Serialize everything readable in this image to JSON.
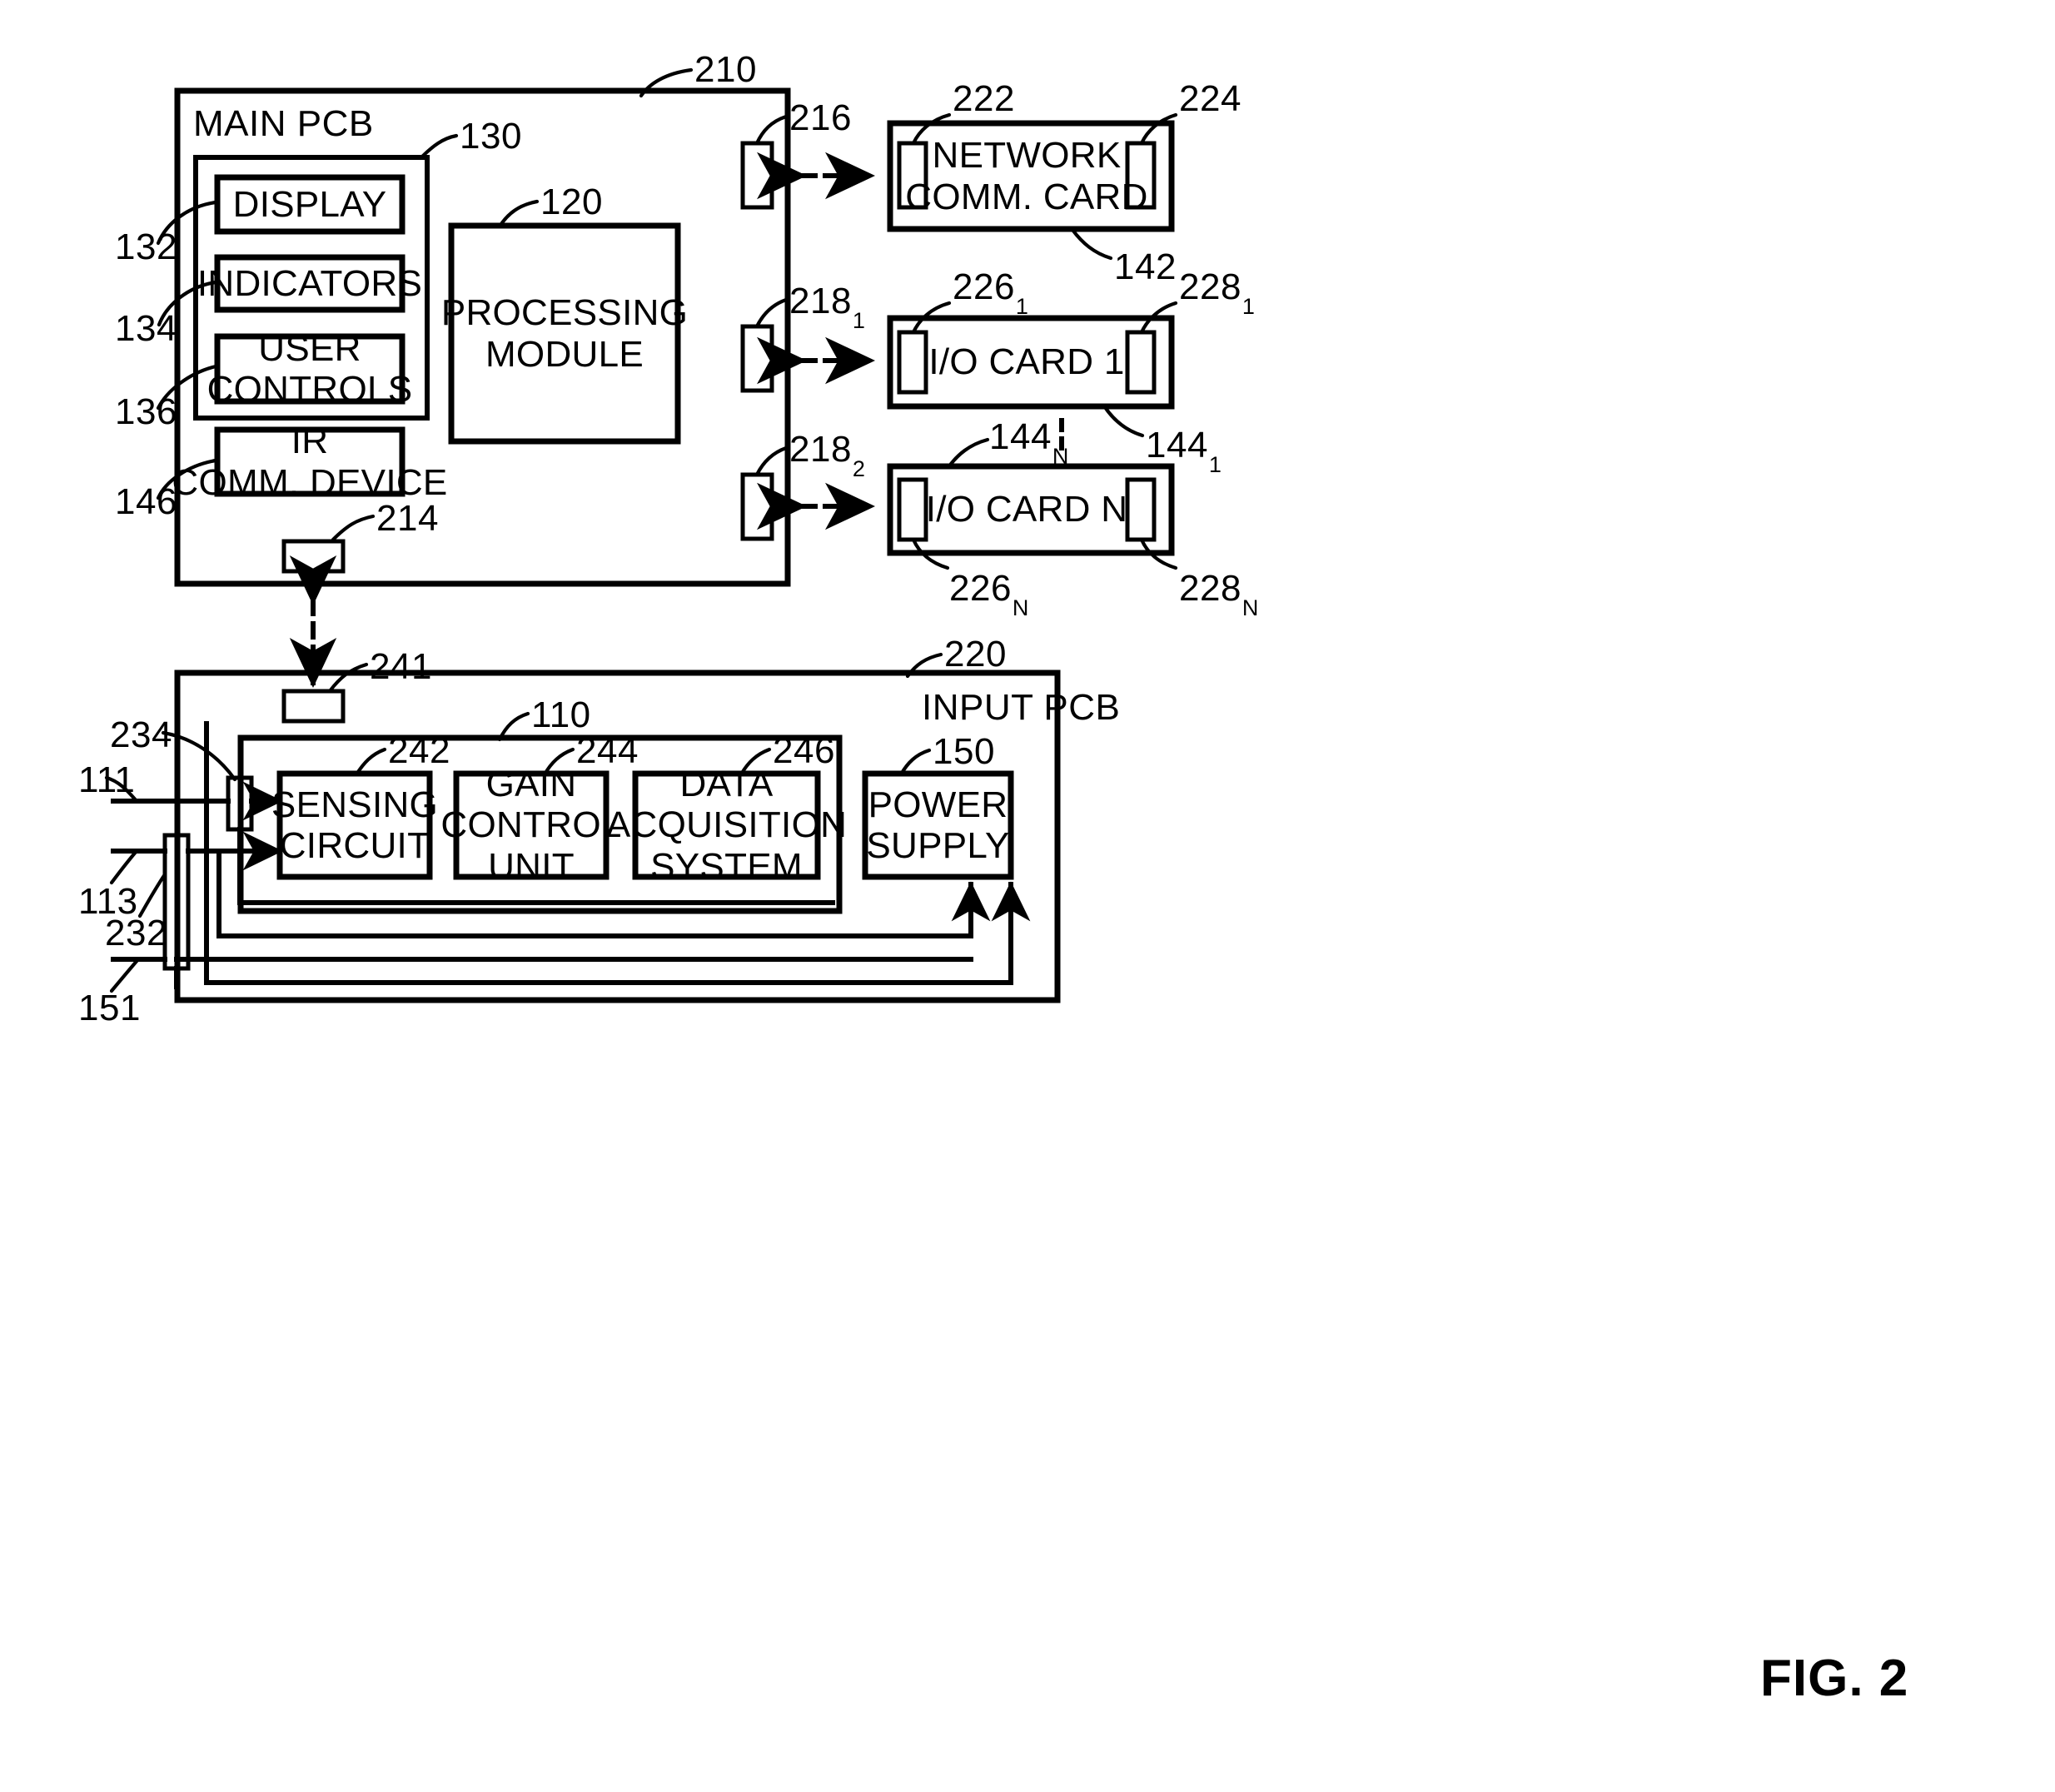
{
  "figure": {
    "caption": "FIG. 2"
  },
  "main_pcb": {
    "title": "MAIN PCB",
    "ref": "210",
    "ui_group_ref": "130",
    "boxes": [
      {
        "label": "DISPLAY",
        "ref": "132"
      },
      {
        "label": "INDICATORS",
        "ref": "134"
      },
      {
        "label": "USER\nCONTROLS",
        "ref": "136"
      },
      {
        "label": "IR\nCOMM. DEVICE",
        "ref": "146"
      }
    ],
    "processing_module": {
      "label": "PROCESSING\nMODULE",
      "ref": "120"
    },
    "bottom_connector_ref": "214",
    "edge_connectors": [
      {
        "ref": "216",
        "sub": ""
      },
      {
        "ref": "218",
        "sub": "1"
      },
      {
        "ref": "218",
        "sub": "2"
      }
    ]
  },
  "cards": [
    {
      "label": "NETWORK\nCOMM. CARD",
      "card_ref": "142",
      "card_sub": "",
      "left_connector_ref": "222",
      "left_connector_sub": "",
      "right_connector_ref": "224",
      "right_connector_sub": ""
    },
    {
      "label": "I/O CARD 1",
      "card_ref": "144",
      "card_sub": "1",
      "left_connector_ref": "226",
      "left_connector_sub": "1",
      "right_connector_ref": "228",
      "right_connector_sub": "1"
    },
    {
      "label": "I/O CARD N",
      "card_ref": "144",
      "card_sub": "N",
      "left_connector_ref": "226",
      "left_connector_sub": "N",
      "right_connector_ref": "228",
      "right_connector_sub": "N"
    }
  ],
  "input_pcb": {
    "title": "INPUT PCB",
    "ref": "220",
    "top_connector_ref": "241",
    "inner_group_ref": "110",
    "boxes": [
      {
        "label": "SENSING\nCIRCUIT",
        "ref": "242"
      },
      {
        "label": "GAIN\nCONTROL\nUNIT",
        "ref": "244"
      },
      {
        "label": "DATA\nACQUISITION\nSYSTEM",
        "ref": "246"
      }
    ],
    "power_supply": {
      "label": "POWER\nSUPPLY",
      "ref": "150"
    },
    "input_lines": [
      {
        "ref": "111"
      },
      {
        "ref": "113"
      },
      {
        "ref": "151"
      }
    ],
    "connectors": [
      {
        "ref": "234"
      },
      {
        "ref": "232"
      }
    ]
  },
  "colors": {
    "stroke": "#000000",
    "background": "#ffffff"
  }
}
